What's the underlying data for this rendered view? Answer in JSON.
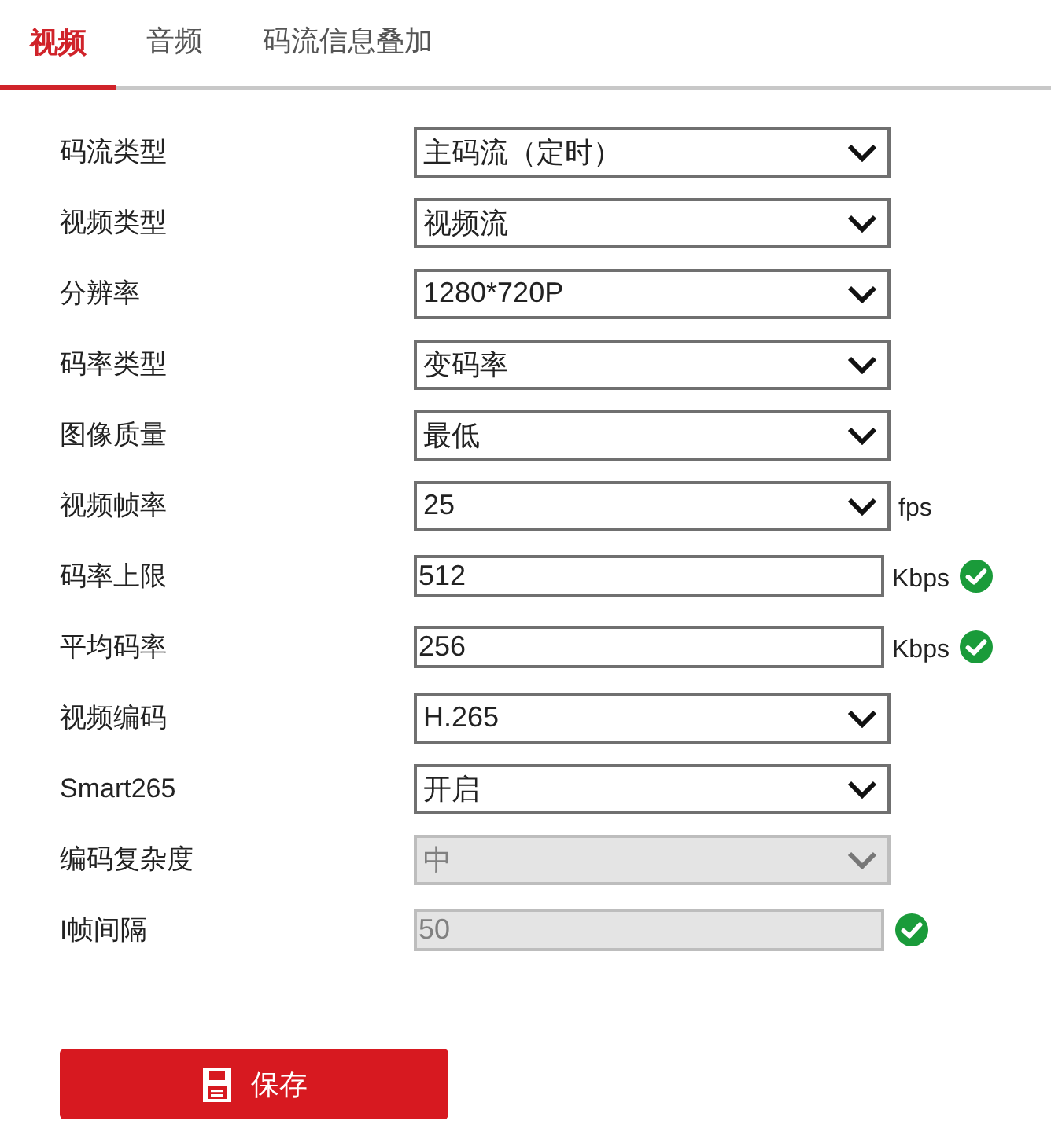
{
  "tabs": [
    {
      "label": "视频",
      "selected": true
    },
    {
      "label": "音频",
      "selected": false
    },
    {
      "label": "码流信息叠加",
      "selected": false
    }
  ],
  "fields": [
    {
      "label": "码流类型",
      "kind": "select",
      "value": "主码流（定时）",
      "disabled": false,
      "valid": false
    },
    {
      "label": "视频类型",
      "kind": "select",
      "value": "视频流",
      "disabled": false,
      "valid": false
    },
    {
      "label": "分辨率",
      "kind": "select",
      "value": "1280*720P",
      "disabled": false,
      "valid": false
    },
    {
      "label": "码率类型",
      "kind": "select",
      "value": "变码率",
      "disabled": false,
      "valid": false
    },
    {
      "label": "图像质量",
      "kind": "select",
      "value": "最低",
      "disabled": false,
      "valid": false
    },
    {
      "label": "视频帧率",
      "kind": "select",
      "value": "25",
      "unit": "fps",
      "disabled": false,
      "valid": false
    },
    {
      "label": "码率上限",
      "kind": "input",
      "value": "512",
      "unit": "Kbps",
      "disabled": false,
      "valid": true
    },
    {
      "label": "平均码率",
      "kind": "input",
      "value": "256",
      "unit": "Kbps",
      "disabled": false,
      "valid": true
    },
    {
      "label": "视频编码",
      "kind": "select",
      "value": "H.265",
      "disabled": false,
      "valid": false
    },
    {
      "label": "Smart265",
      "kind": "select",
      "value": "开启",
      "disabled": false,
      "valid": false
    },
    {
      "label": "编码复杂度",
      "kind": "select",
      "value": "中",
      "disabled": true,
      "valid": false
    },
    {
      "label": "I帧间隔",
      "kind": "input",
      "value": "50",
      "disabled": true,
      "valid": true
    }
  ],
  "save_button": {
    "label": "保存"
  }
}
